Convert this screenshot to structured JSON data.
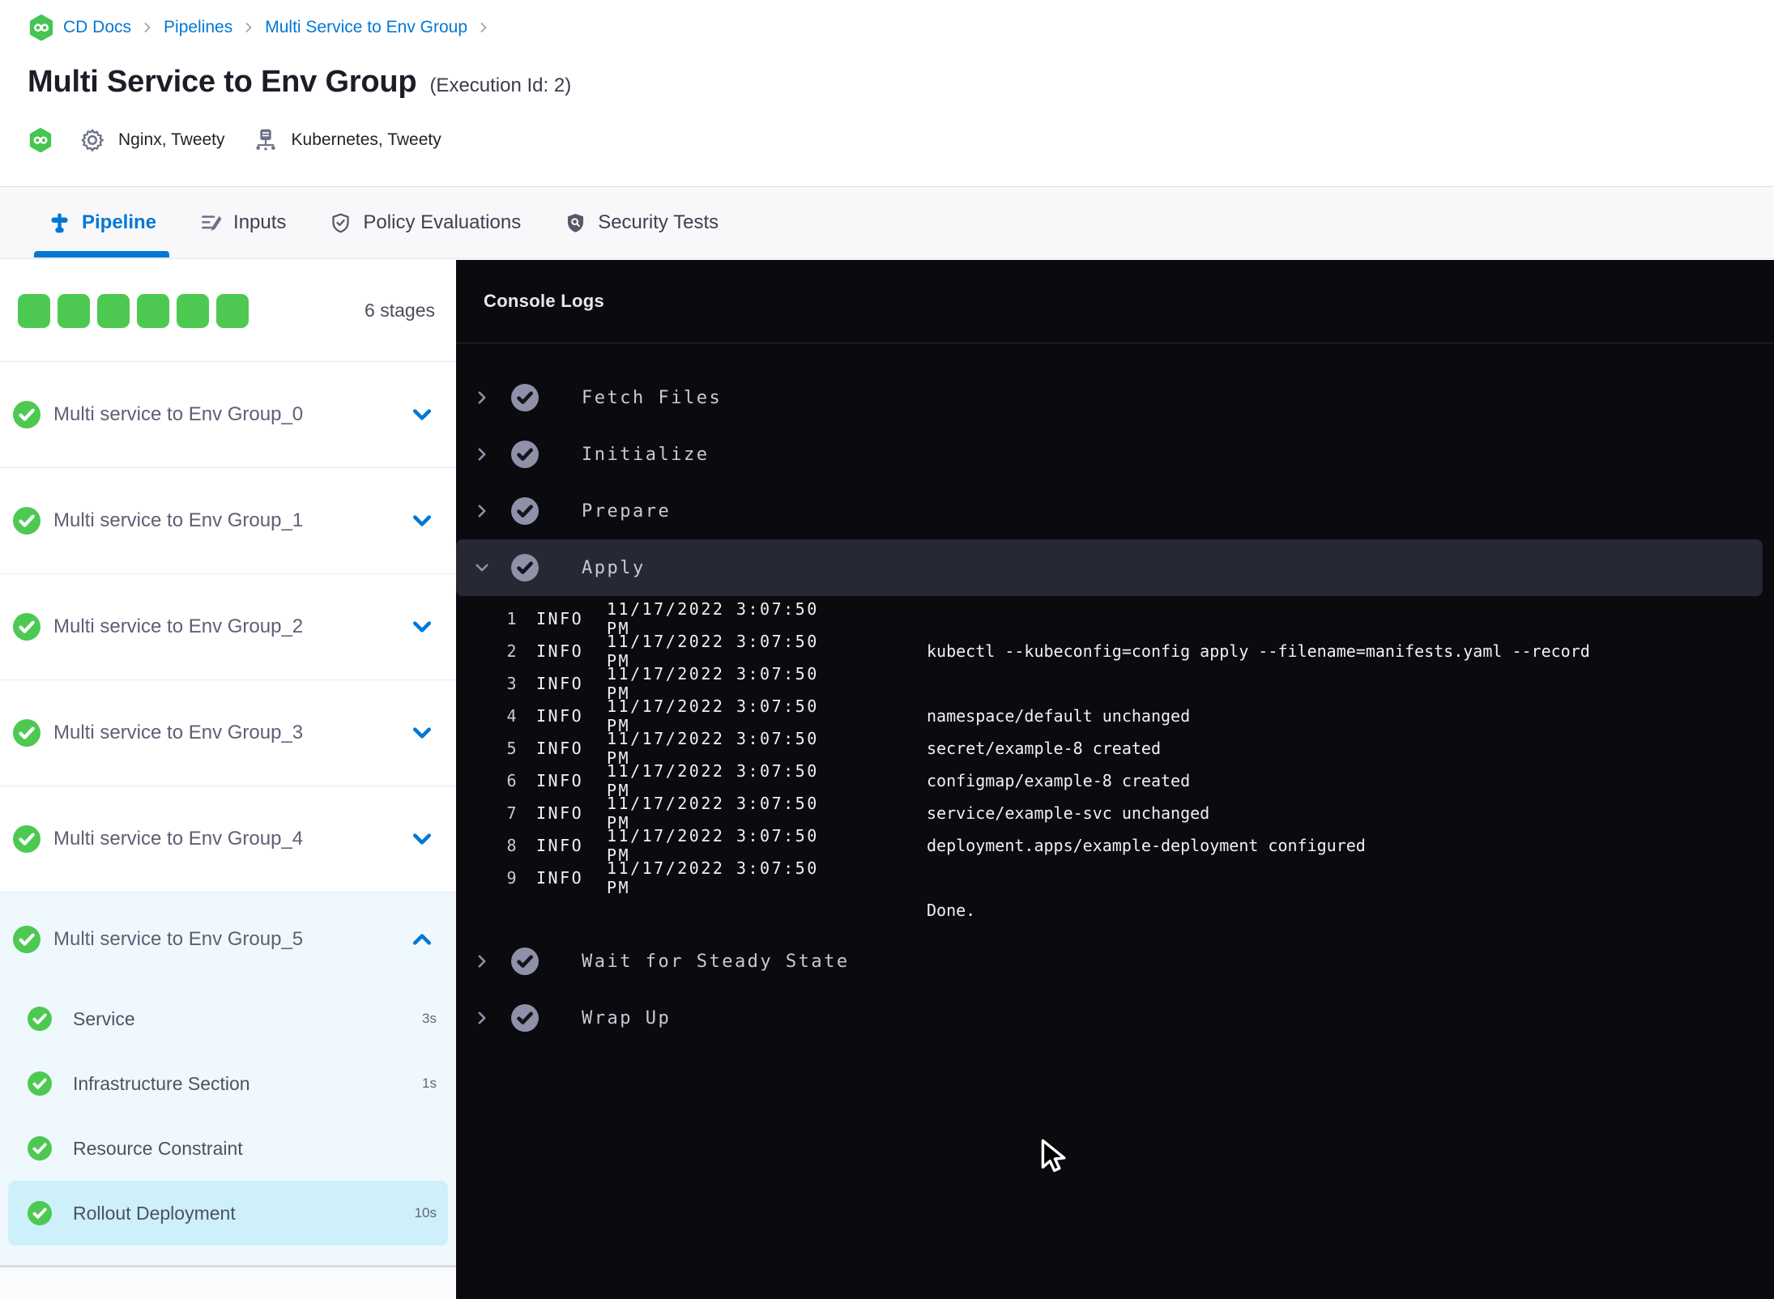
{
  "colors": {
    "accent_blue": "#0278d5",
    "success_green": "#4dc952",
    "console_bg": "#0b0b0f",
    "expanded_stage_bg": "#eff9fd",
    "selected_step_bg": "#cdf0fb",
    "expanded_console_row_bg": "#262834"
  },
  "breadcrumb": {
    "links": [
      "CD Docs",
      "Pipelines",
      "Multi Service to Env Group"
    ]
  },
  "header": {
    "title": "Multi Service to Env Group",
    "execution_id": "(Execution Id: 2)",
    "services_label": "Nginx, Tweety",
    "environments_label": "Kubernetes, Tweety"
  },
  "tabs": [
    {
      "label": "Pipeline",
      "icon": "pipeline-icon",
      "active": true
    },
    {
      "label": "Inputs",
      "icon": "inputs-icon",
      "active": false
    },
    {
      "label": "Policy Evaluations",
      "icon": "policy-shield-icon",
      "active": false
    },
    {
      "label": "Security Tests",
      "icon": "security-shield-icon",
      "active": false
    }
  ],
  "stages_panel": {
    "progress_squares": 6,
    "count_label": "6 stages",
    "stages": [
      "Multi service to Env Group_0",
      "Multi service to Env Group_1",
      "Multi service to Env Group_2",
      "Multi service to Env Group_3",
      "Multi service to Env Group_4"
    ],
    "expanded_stage": {
      "name": "Multi service to Env Group_5",
      "steps": [
        {
          "label": "Service",
          "duration": "3s",
          "selected": false
        },
        {
          "label": "Infrastructure Section",
          "duration": "1s",
          "selected": false
        },
        {
          "label": "Resource Constraint",
          "duration": "",
          "selected": false
        },
        {
          "label": "Rollout Deployment",
          "duration": "10s",
          "selected": true
        }
      ]
    }
  },
  "console": {
    "title": "Console Logs",
    "steps_before": [
      "Fetch Files",
      "Initialize",
      "Prepare"
    ],
    "expanded_step": "Apply",
    "steps_after": [
      "Wait for Steady State",
      "Wrap Up"
    ],
    "logs": [
      {
        "n": "1",
        "level": "INFO",
        "time": "11/17/2022 3:07:50 PM",
        "message": ""
      },
      {
        "n": "2",
        "level": "INFO",
        "time": "11/17/2022 3:07:50 PM",
        "message": "kubectl --kubeconfig=config apply --filename=manifests.yaml --record"
      },
      {
        "n": "3",
        "level": "INFO",
        "time": "11/17/2022 3:07:50 PM",
        "message": ""
      },
      {
        "n": "4",
        "level": "INFO",
        "time": "11/17/2022 3:07:50 PM",
        "message": "namespace/default unchanged"
      },
      {
        "n": "5",
        "level": "INFO",
        "time": "11/17/2022 3:07:50 PM",
        "message": "secret/example-8 created"
      },
      {
        "n": "6",
        "level": "INFO",
        "time": "11/17/2022 3:07:50 PM",
        "message": "configmap/example-8 created"
      },
      {
        "n": "7",
        "level": "INFO",
        "time": "11/17/2022 3:07:50 PM",
        "message": "service/example-svc unchanged"
      },
      {
        "n": "8",
        "level": "INFO",
        "time": "11/17/2022 3:07:50 PM",
        "message": "deployment.apps/example-deployment configured"
      },
      {
        "n": "9",
        "level": "INFO",
        "time": "11/17/2022 3:07:50 PM",
        "message": ""
      }
    ],
    "final_line": "Done."
  }
}
